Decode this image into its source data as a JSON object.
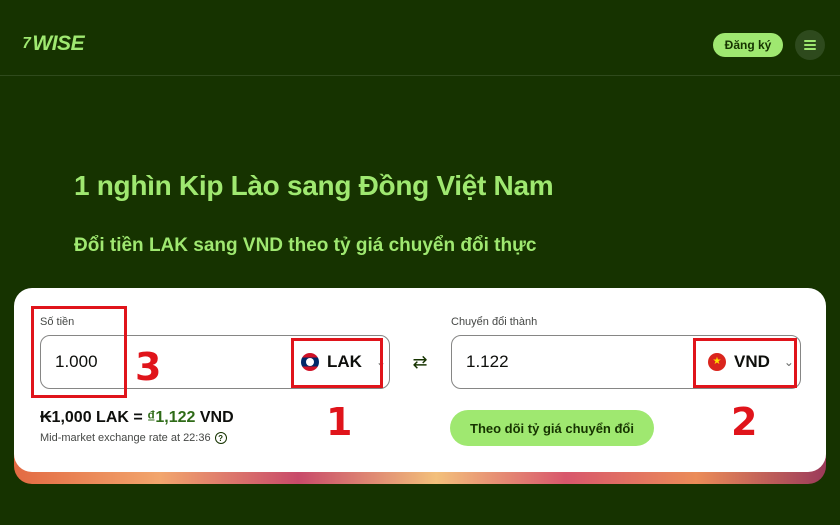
{
  "header": {
    "logo_text": "WISE",
    "logo_mark": "7",
    "signup_label": "Đăng ký",
    "menu_icon": "hamburger-menu-icon"
  },
  "hero": {
    "title": "1 nghìn Kip Lào sang Đồng Việt Nam",
    "subtitle": "Đổi tiền LAK sang VND theo tỷ giá chuyển đổi thực"
  },
  "converter": {
    "amount_label": "Số tiền",
    "amount_value": "1.000",
    "from_currency": "LAK",
    "from_flag": "laos-flag-icon",
    "convert_label": "Chuyển đổi thành",
    "converted_value": "1.122",
    "to_currency": "VND",
    "to_flag": "vietnam-flag-icon",
    "swap_icon": "swap-arrows-icon",
    "rate_prefix": "₭1,000 LAK = ",
    "rate_currency_symbol": "₫",
    "rate_value": "1,122",
    "rate_suffix": " VND",
    "midmarket_text": "Mid-market exchange rate at 22:36",
    "help_icon": "?",
    "track_button_label": "Theo dõi tỷ giá chuyển đổi"
  },
  "annotations": {
    "label_1": "1",
    "label_2": "2",
    "label_3": "3",
    "color": "#e0141b"
  },
  "colors": {
    "background": "#163300",
    "accent": "#9fe870",
    "card": "#ffffff"
  }
}
